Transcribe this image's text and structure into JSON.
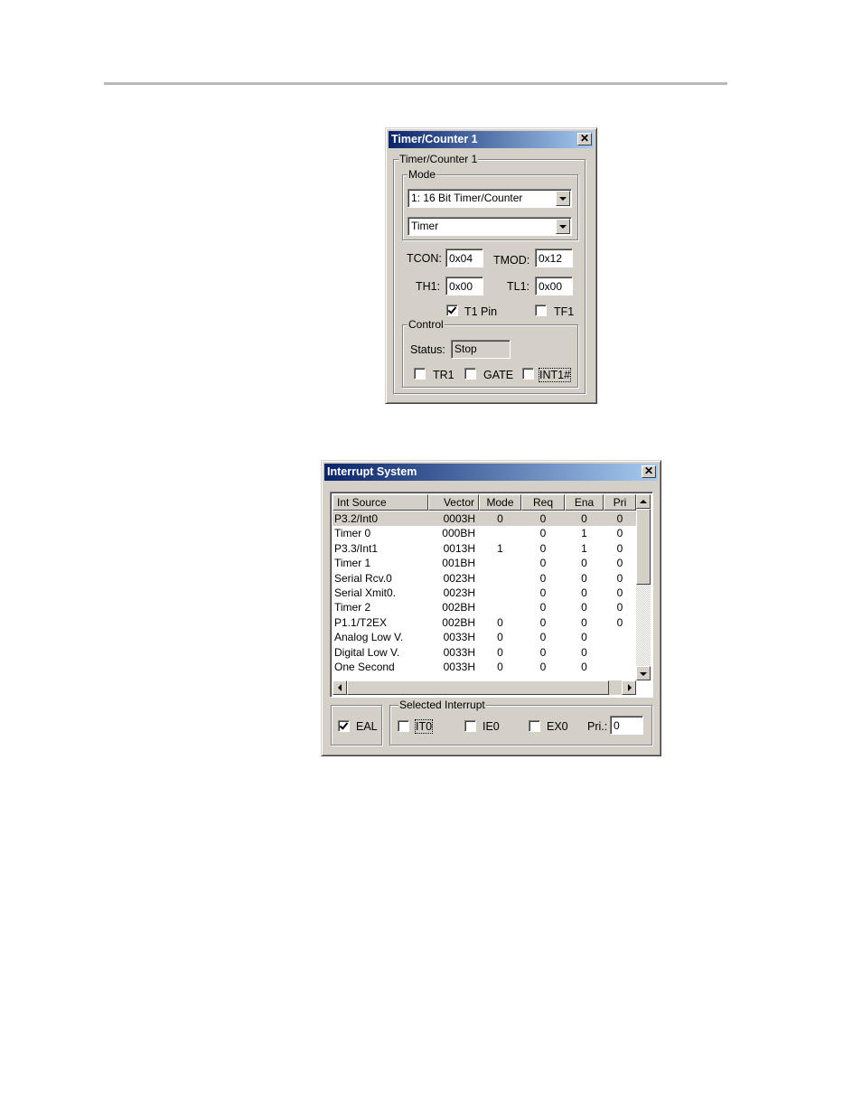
{
  "timer_dialog": {
    "title": "Timer/Counter 1",
    "group_label": "Timer/Counter 1",
    "mode_group_label": "Mode",
    "mode_select": "1: 16 Bit Timer/Counter",
    "type_select": "Timer",
    "tcon_label": "TCON:",
    "tcon_value": "0x04",
    "tmod_label": "TMOD:",
    "tmod_value": "0x12",
    "th1_label": "TH1:",
    "th1_value": "0x00",
    "tl1_label": "TL1:",
    "tl1_value": "0x00",
    "t1pin_label": "T1 Pin",
    "t1pin_checked": true,
    "tf1_label": "TF1",
    "tf1_checked": false,
    "control_group_label": "Control",
    "status_label": "Status:",
    "status_value": "Stop",
    "tr1_label": "TR1",
    "gate_label": "GATE",
    "int1_label": "INT1#"
  },
  "interrupt_dialog": {
    "title": "Interrupt System",
    "columns": [
      "Int Source",
      "Vector",
      "Mode",
      "Req",
      "Ena",
      "Pri"
    ],
    "rows": [
      {
        "source": "P3.2/Int0",
        "vector": "0003H",
        "mode": "0",
        "req": "0",
        "ena": "0",
        "pri": "0",
        "selected": true
      },
      {
        "source": "Timer 0",
        "vector": "000BH",
        "mode": "",
        "req": "0",
        "ena": "1",
        "pri": "0"
      },
      {
        "source": "P3.3/Int1",
        "vector": "0013H",
        "mode": "1",
        "req": "0",
        "ena": "1",
        "pri": "0"
      },
      {
        "source": "Timer 1",
        "vector": "001BH",
        "mode": "",
        "req": "0",
        "ena": "0",
        "pri": "0"
      },
      {
        "source": "Serial Rcv.0",
        "vector": "0023H",
        "mode": "",
        "req": "0",
        "ena": "0",
        "pri": "0"
      },
      {
        "source": "Serial Xmit0.",
        "vector": "0023H",
        "mode": "",
        "req": "0",
        "ena": "0",
        "pri": "0"
      },
      {
        "source": "Timer 2",
        "vector": "002BH",
        "mode": "",
        "req": "0",
        "ena": "0",
        "pri": "0"
      },
      {
        "source": "P1.1/T2EX",
        "vector": "002BH",
        "mode": "0",
        "req": "0",
        "ena": "0",
        "pri": "0"
      },
      {
        "source": "Analog Low V.",
        "vector": "0033H",
        "mode": "0",
        "req": "0",
        "ena": "0",
        "pri": ""
      },
      {
        "source": "Digital Low V.",
        "vector": "0033H",
        "mode": "0",
        "req": "0",
        "ena": "0",
        "pri": ""
      },
      {
        "source": "One Second",
        "vector": "0033H",
        "mode": "0",
        "req": "0",
        "ena": "0",
        "pri": ""
      }
    ],
    "eal_label": "EAL",
    "eal_checked": true,
    "selected_group_label": "Selected Interrupt",
    "it0_label": "IT0",
    "ie0_label": "IE0",
    "ex0_label": "EX0",
    "pri_label": "Pri.:",
    "pri_value": "0"
  }
}
